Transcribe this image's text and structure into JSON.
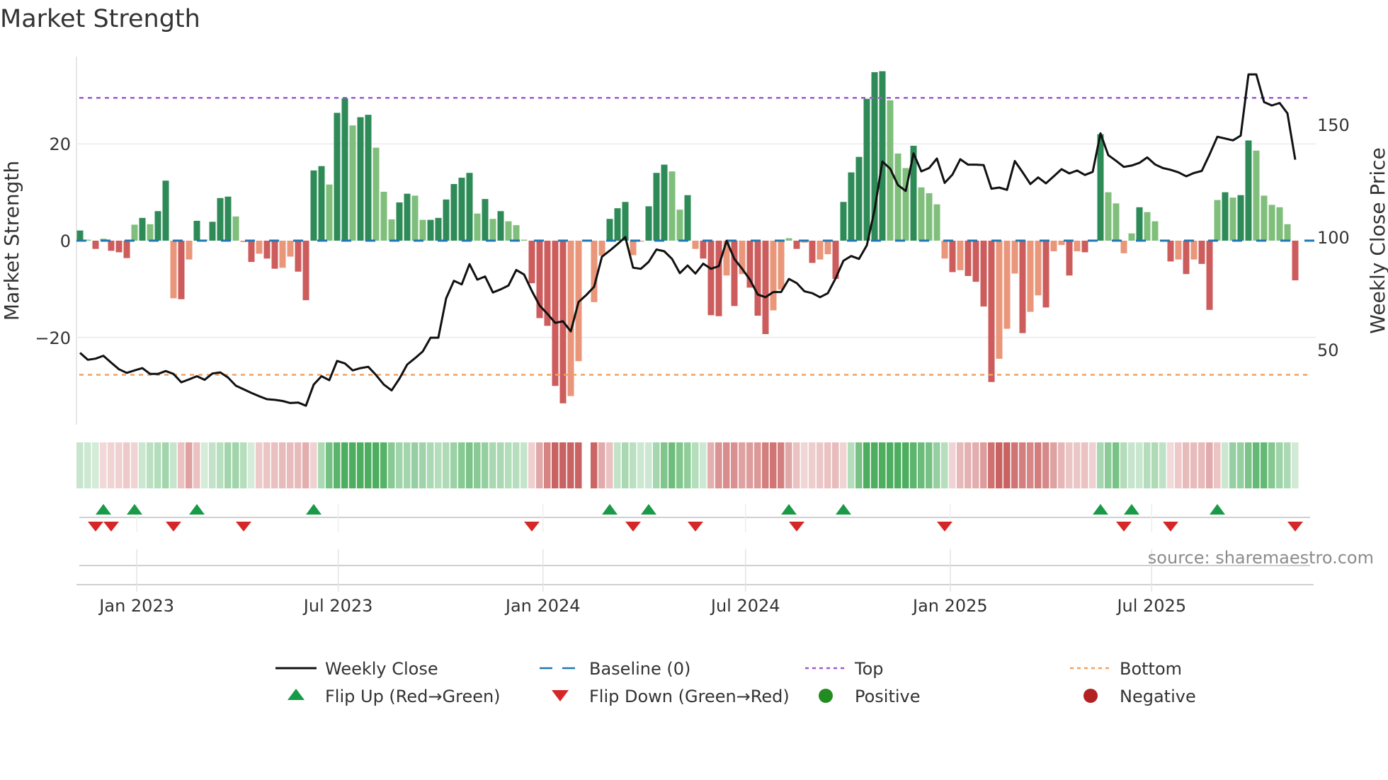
{
  "chart_data": {
    "type": "bar",
    "title": "Market Strength",
    "ylabel": "Market Strength",
    "y2label": "Weekly Close Price",
    "ylim": [
      -38,
      38
    ],
    "y2lim": [
      20,
      185
    ],
    "y_ticks": [
      {
        "value": 20,
        "label": "20"
      },
      {
        "value": 0,
        "label": "0"
      },
      {
        "value": -20,
        "label": "−20"
      }
    ],
    "y2_ticks": [
      {
        "value": 150,
        "label": "150"
      },
      {
        "value": 100,
        "label": "100"
      },
      {
        "value": 50,
        "label": "50"
      }
    ],
    "x_ticks": [
      {
        "date": "2023-01-01",
        "label": "Jan 2023"
      },
      {
        "date": "2023-07-01",
        "label": "Jul 2023"
      },
      {
        "date": "2024-01-01",
        "label": "Jan 2024"
      },
      {
        "date": "2024-07-01",
        "label": "Jul 2024"
      },
      {
        "date": "2025-01-01",
        "label": "Jan 2025"
      },
      {
        "date": "2025-07-01",
        "label": "Jul 2025"
      }
    ],
    "start_date": "2022-11-11",
    "frequency": "weekly",
    "top_level": 29.5,
    "bottom_level": -27.7,
    "baseline": 0,
    "strength": [
      2.1,
      0.2,
      -1.7,
      0.4,
      -2.1,
      -2.4,
      -3.6,
      3.3,
      4.7,
      3.4,
      6.1,
      12.4,
      -11.9,
      -12.1,
      -3.9,
      4.1,
      0.2,
      3.9,
      8.8,
      9.1,
      5.0,
      -0.3,
      -4.4,
      -2.7,
      -3.7,
      -5.8,
      -5.6,
      -3.3,
      -6.4,
      -12.3,
      14.5,
      15.4,
      11.6,
      26.4,
      29.4,
      23.8,
      25.5,
      26.0,
      19.2,
      10.1,
      4.4,
      7.9,
      9.7,
      9.3,
      4.3,
      4.3,
      4.7,
      8.5,
      11.7,
      13.0,
      14.0,
      5.6,
      8.6,
      4.5,
      6.1,
      4.0,
      3.2,
      0.2,
      -8.8,
      -16.0,
      -17.6,
      -30.0,
      -33.6,
      -32.1,
      -24.9,
      null,
      -12.7,
      -3.1,
      4.5,
      6.7,
      8.0,
      -3.0,
      -0.2,
      7.1,
      14.0,
      15.7,
      14.3,
      6.4,
      9.4,
      -1.7,
      -3.7,
      -15.4,
      -15.6,
      -7.2,
      -13.5,
      -6.9,
      -9.7,
      -15.5,
      -19.3,
      -14.4,
      -10.1,
      0.5,
      -1.7,
      -0.4,
      -4.6,
      -3.9,
      -2.8,
      -7.9,
      8.0,
      14.1,
      17.3,
      29.3,
      34.8,
      35.0,
      29.0,
      18.0,
      15.0,
      19.6,
      11.0,
      9.8,
      7.5,
      -3.7,
      -6.5,
      -6.1,
      -7.3,
      -8.5,
      -13.6,
      -29.2,
      -24.4,
      -18.2,
      -6.8,
      -19.1,
      -14.7,
      -11.3,
      -13.8,
      -2.2,
      -0.9,
      -7.2,
      -2.2,
      -2.4,
      -0.2,
      22.0,
      10.0,
      7.7,
      -2.6,
      1.5,
      6.9,
      5.9,
      4.0,
      0.2,
      -4.3,
      -3.9,
      -6.9,
      -3.9,
      -4.8,
      -14.3,
      8.4,
      10.0,
      8.9,
      9.4,
      20.7,
      18.6,
      9.3,
      7.4,
      6.9,
      3.4,
      -8.2
    ],
    "weekly_close": [
      48.6,
      45.5,
      46.0,
      47.3,
      44.2,
      41.3,
      39.7,
      40.8,
      41.8,
      39.2,
      39.2,
      40.5,
      39.2,
      35.5,
      36.8,
      38.2,
      36.6,
      39.4,
      39.9,
      37.6,
      34.0,
      32.4,
      30.8,
      29.3,
      28.0,
      27.7,
      27.2,
      26.3,
      26.5,
      25.1,
      34.5,
      38.2,
      36.4,
      45.0,
      43.9,
      40.8,
      41.8,
      42.4,
      38.7,
      34.5,
      31.9,
      37.1,
      43.4,
      46.2,
      49.2,
      55.3,
      55.3,
      72.8,
      80.6,
      79.0,
      88.0,
      81.1,
      82.5,
      75.4,
      76.8,
      78.5,
      85.4,
      83.4,
      76.1,
      69.6,
      65.9,
      61.9,
      62.6,
      58.1,
      71.2,
      74.3,
      78.0,
      91.3,
      94.0,
      96.9,
      100.0,
      86.4,
      85.9,
      89.0,
      94.5,
      93.7,
      90.3,
      84.0,
      87.4,
      83.8,
      88.2,
      85.9,
      87.1,
      98.4,
      90.3,
      85.9,
      81.1,
      74.5,
      73.3,
      75.6,
      75.6,
      81.4,
      79.6,
      75.9,
      75.1,
      73.3,
      75.1,
      81.7,
      89.5,
      91.6,
      90.3,
      96.3,
      112.1,
      133.6,
      130.4,
      123.1,
      120.5,
      137.2,
      129.2,
      130.7,
      134.9,
      124.1,
      127.8,
      134.6,
      132.2,
      132.2,
      132.0,
      121.5,
      122.0,
      121.0,
      133.8,
      128.8,
      123.6,
      126.5,
      123.9,
      127.0,
      130.2,
      128.3,
      129.6,
      127.6,
      129.0,
      146.1,
      136.4,
      133.9,
      131.2,
      131.8,
      133.0,
      135.4,
      132.3,
      130.7,
      129.9,
      128.8,
      127.0,
      128.5,
      129.4,
      136.7,
      144.6,
      143.8,
      143.0,
      145.1,
      172.3,
      172.3,
      160.0,
      158.5,
      159.6,
      155.0,
      134.4
    ],
    "colors": {
      "strong_green": "#2e8b57",
      "weak_green": "#7fbf7b",
      "strong_red": "#cd5c5c",
      "weak_red": "#e9967a",
      "price": "#111111",
      "baseline": "#1f77b4",
      "top": "#9b59d0",
      "bottom": "#f0a060",
      "flip_up": "#1a9a48",
      "flip_down": "#d62728",
      "positive": "#228b22",
      "negative": "#b22222"
    },
    "legend": [
      {
        "key": "close",
        "label": "Weekly Close"
      },
      {
        "key": "baseline",
        "label": "Baseline (0)"
      },
      {
        "key": "top",
        "label": "Top"
      },
      {
        "key": "bottom",
        "label": "Bottom"
      },
      {
        "key": "flip_up",
        "label": "Flip Up (Red→Green)"
      },
      {
        "key": "flip_down",
        "label": "Flip Down (Green→Red)"
      },
      {
        "key": "positive",
        "label": "Positive"
      },
      {
        "key": "negative",
        "label": "Negative"
      }
    ],
    "legend_placement": "bottom-center",
    "source": "source: sharemaestro.com"
  }
}
